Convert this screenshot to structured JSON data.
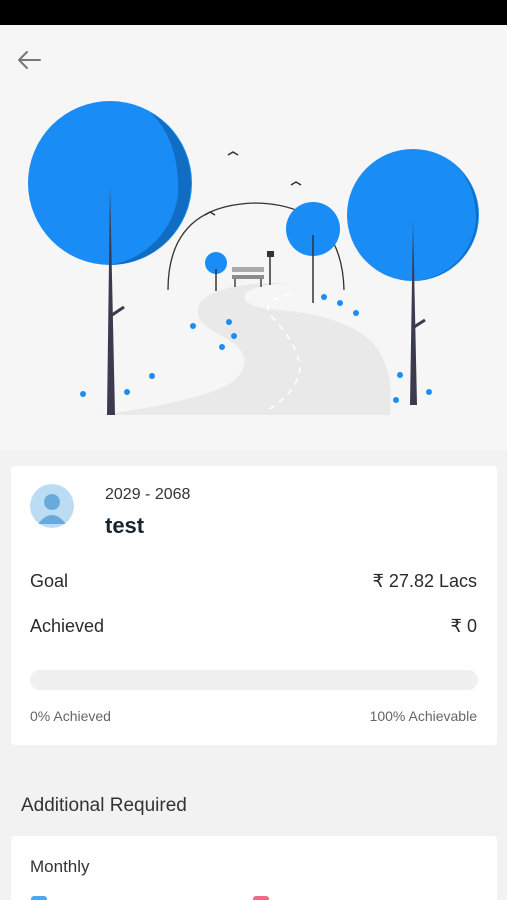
{
  "header": {
    "back_icon": "arrow-left-icon"
  },
  "goal": {
    "years": "2029 - 2068",
    "name": "test",
    "goal_label": "Goal",
    "goal_value": "₹ 27.82 Lacs",
    "achieved_label": "Achieved",
    "achieved_value": "₹ 0",
    "progress_fraction": 0,
    "achieved_pct_label": "0% Achieved",
    "achievable_pct_label": "100% Achievable"
  },
  "additional": {
    "section_title": "Additional Required",
    "monthly_label": "Monthly"
  },
  "colors": {
    "accent": "#1a8cf5",
    "legend_blue": "#4aa8f0",
    "legend_pink": "#f06a86"
  }
}
